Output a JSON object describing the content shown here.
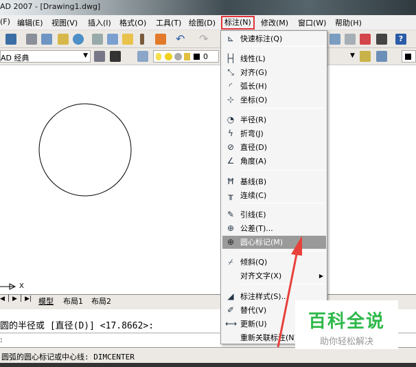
{
  "window": {
    "title": "AD 2007 - [Drawing1.dwg]"
  },
  "menubar": [
    "(F)",
    "编辑(E)",
    "视图(V)",
    "插入(I)",
    "格式(O)",
    "工具(T)",
    "绘图(D)",
    "标注(N)",
    "修改(M)",
    "窗口(W)",
    "帮助(H)"
  ],
  "toolbar": {
    "workspace": "AD 经典",
    "layer": "0"
  },
  "dimension_menu": {
    "items": [
      {
        "label": "快速标注(Q)",
        "icon": "quick-dim-icon"
      },
      {
        "label": "线性(L)",
        "icon": "linear-icon"
      },
      {
        "label": "对齐(G)",
        "icon": "aligned-icon"
      },
      {
        "label": "弧长(H)",
        "icon": "arc-length-icon"
      },
      {
        "label": "坐标(O)",
        "icon": "ordinate-icon"
      },
      {
        "label": "半径(R)",
        "icon": "radius-icon"
      },
      {
        "label": "折弯(J)",
        "icon": "jogged-icon"
      },
      {
        "label": "直径(D)",
        "icon": "diameter-icon"
      },
      {
        "label": "角度(A)",
        "icon": "angular-icon"
      },
      {
        "label": "基线(B)",
        "icon": "baseline-icon"
      },
      {
        "label": "连续(C)",
        "icon": "continue-icon"
      },
      {
        "label": "引线(E)",
        "icon": "leader-icon"
      },
      {
        "label": "公差(T)...",
        "icon": "tolerance-icon"
      },
      {
        "label": "圆心标记(M)",
        "icon": "center-mark-icon",
        "highlighted": true
      },
      {
        "label": "倾斜(Q)",
        "icon": "oblique-icon"
      },
      {
        "label": "对齐文字(X)",
        "submenu": true
      },
      {
        "label": "标注样式(S)...",
        "icon": "dim-style-icon"
      },
      {
        "label": "替代(V)",
        "icon": "override-icon"
      },
      {
        "label": "更新(U)",
        "icon": "update-icon"
      },
      {
        "label": "重新关联标注(N)"
      }
    ]
  },
  "canvas": {
    "axis_label": "X"
  },
  "tabs": [
    "模型",
    "布局1",
    "布局2"
  ],
  "command": {
    "line1": "圆的半径或 [直径(D)] <17.8662>:",
    "line2": ":"
  },
  "status": {
    "text": "圆弧的圆心标记或中心线:  DIMCENTER"
  },
  "watermark": {
    "title": "百科全说",
    "subtitle": "助你轻松解决",
    "color": "#2db84a"
  },
  "colors": {
    "highlight_box": "#e0363a",
    "arrow": "#e8403a",
    "menu_highlight": "#9a9a9a"
  }
}
